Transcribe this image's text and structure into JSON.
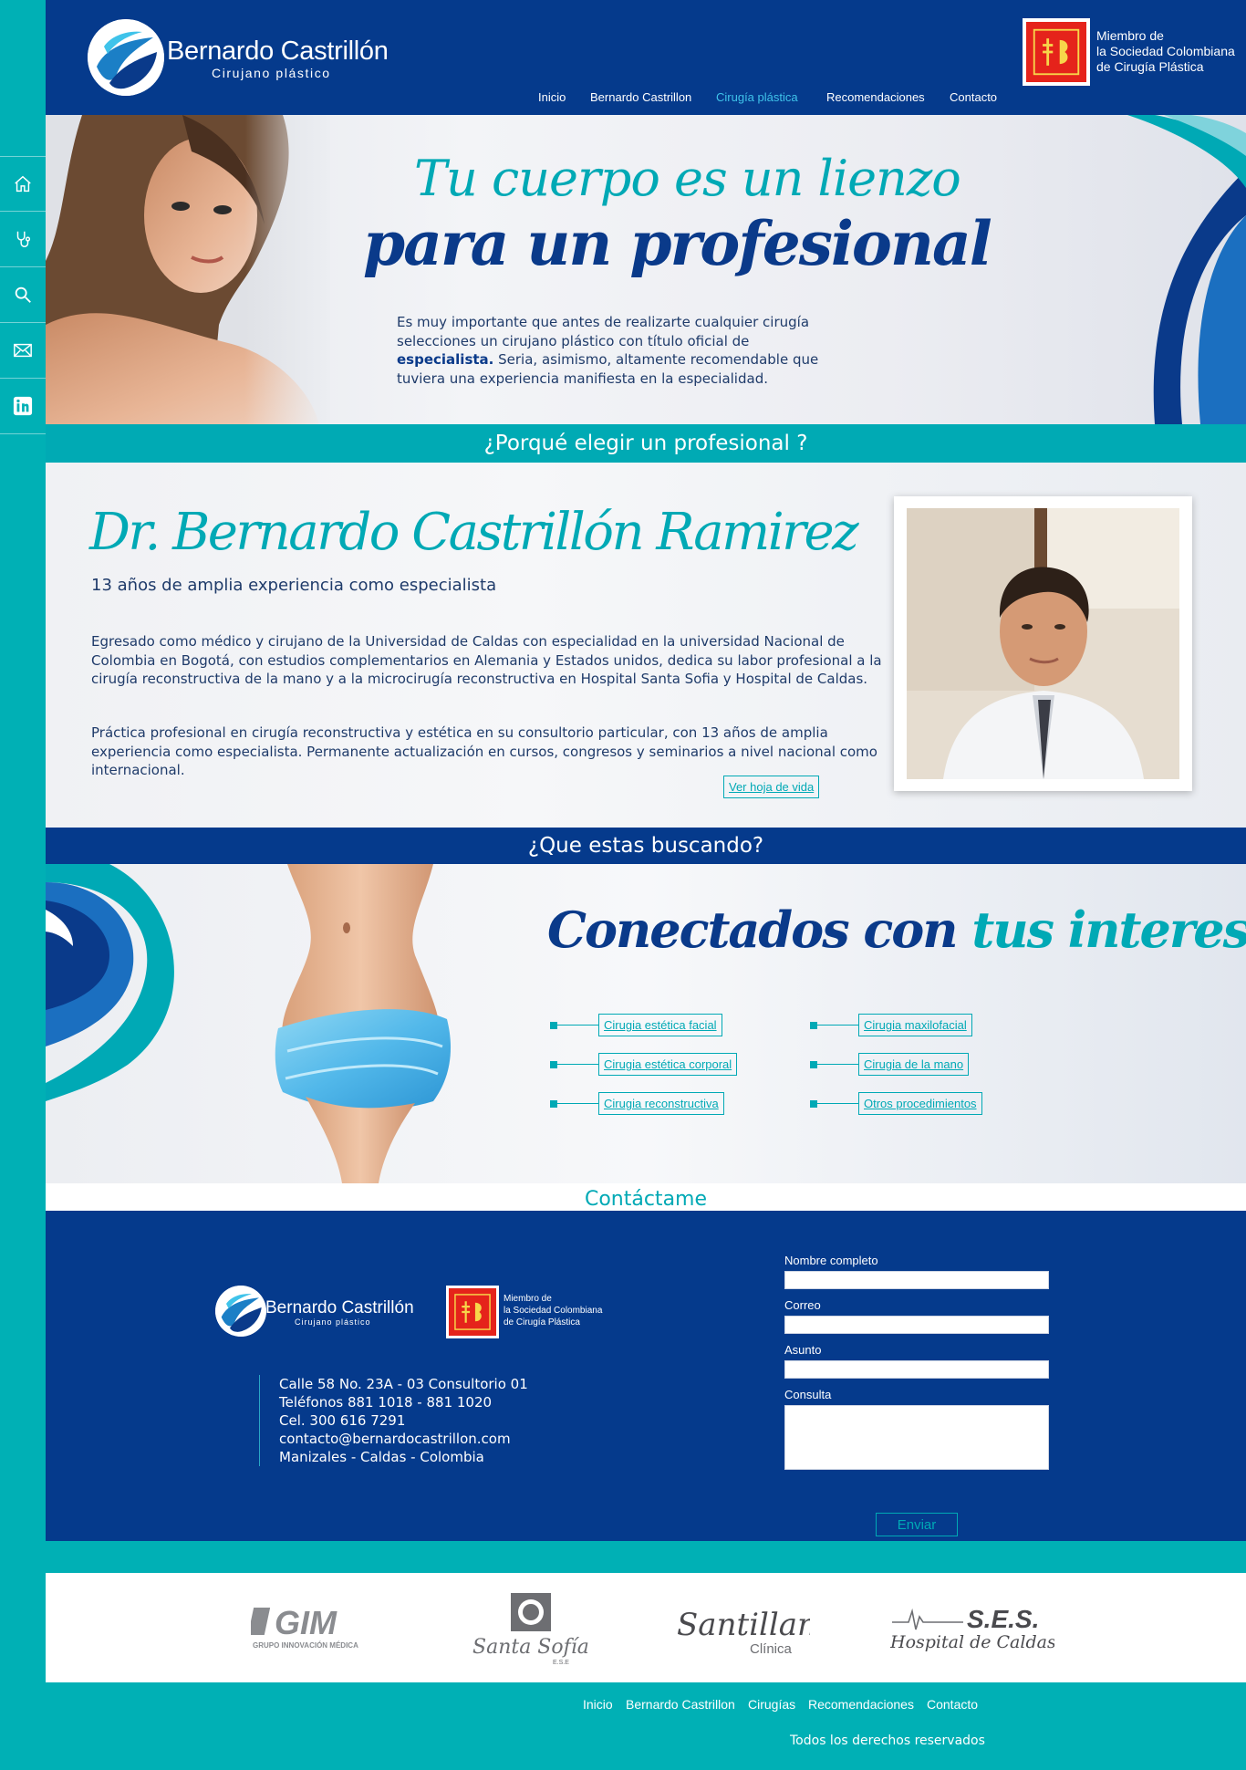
{
  "brand": {
    "name": "Bernardo Castrillón",
    "tagline": "Cirujano plástico",
    "society_line1": "Miembro de",
    "society_line2": "la Sociedad Colombiana",
    "society_line3": "de Cirugía Plástica"
  },
  "nav": {
    "items": [
      "Inicio",
      "Bernardo Castrillon",
      "Cirugía plástica",
      "Recomendaciones",
      "Contacto"
    ],
    "active": "Cirugía plástica"
  },
  "sidebar": {
    "icons": [
      "home-icon",
      "stethoscope-icon",
      "search-icon",
      "mail-icon",
      "linkedin-icon"
    ]
  },
  "hero": {
    "title_line1": "Tu cuerpo es un lienzo",
    "title_line2": "para un profesional",
    "text_before": "Es muy importante que antes de realizarte cualquier cirugía selecciones un cirujano plástico con título oficial de ",
    "text_bold": "especialista.",
    "text_after": " Seria, asimismo, altamente recomendable que tuviera una experiencia manifiesta en la especialidad."
  },
  "why": {
    "heading": "¿Porqué elegir un profesional ?"
  },
  "doctor": {
    "name": "Dr. Bernardo Castrillón Ramirez",
    "subtitle": "13 años de amplia experiencia como especialista",
    "paragraph1": "Egresado como médico y cirujano de la Universidad de Caldas con especialidad en la universidad Nacional de Colombia en Bogotá, con estudios complementarios en Alemania y Estados unidos, dedica su labor profesional a la cirugía reconstructiva de la mano y a la microcirugía reconstructiva en Hospital Santa Sofia y Hospital de Caldas.",
    "paragraph2": "Práctica profesional en cirugía reconstructiva y estética en su consultorio particular, con 13 años de amplia experiencia como especialista. Permanente actualización en cursos, congresos y seminarios a nivel nacional como internacional.",
    "cv_button": "Ver hoja de vida"
  },
  "services": {
    "heading": "¿Que estas buscando?",
    "title_part1": "Conectados con",
    "title_part2": "tus intereses",
    "items": [
      "Cirugia estética facial",
      "Cirugia estética corporal",
      "Cirugia reconstructiva",
      "Cirugia maxilofacial",
      "Cirugia de la mano",
      "Otros procedimientos"
    ]
  },
  "contact": {
    "heading": "Contáctame",
    "address": "Calle 58 No. 23A - 03 Consultorio 01",
    "phones": "Teléfonos 881 1018 - 881 1020",
    "cell": "Cel. 300 616 7291",
    "email": "contacto@bernardocastrillon.com",
    "city": "Manizales - Caldas - Colombia",
    "form": {
      "name_label": "Nombre completo",
      "email_label": "Correo",
      "subject_label": "Asunto",
      "message_label": "Consulta",
      "submit_label": "Enviar"
    }
  },
  "partners": {
    "gim_name": "GIM",
    "gim_sub": "GRUPO INNOVACIÓN MÉDICA",
    "santa_sofia_name": "Santa Sofía",
    "santa_sofia_sub": "E.S.E",
    "santillana_name": "Santillana",
    "santillana_sub": "Clínica",
    "ses_name": "S.E.S.",
    "ses_sub": "Hospital de Caldas"
  },
  "footer": {
    "nav": [
      "Inicio",
      "Bernardo Castrillon",
      "Cirugías",
      "Recomendaciones",
      "Contacto"
    ],
    "copyright": "Todos los derechos reservados"
  },
  "colors": {
    "teal": "#00b0b5",
    "navy": "#053a8c",
    "accent_blue": "#3fc3ea",
    "society_red": "#e5231b"
  }
}
